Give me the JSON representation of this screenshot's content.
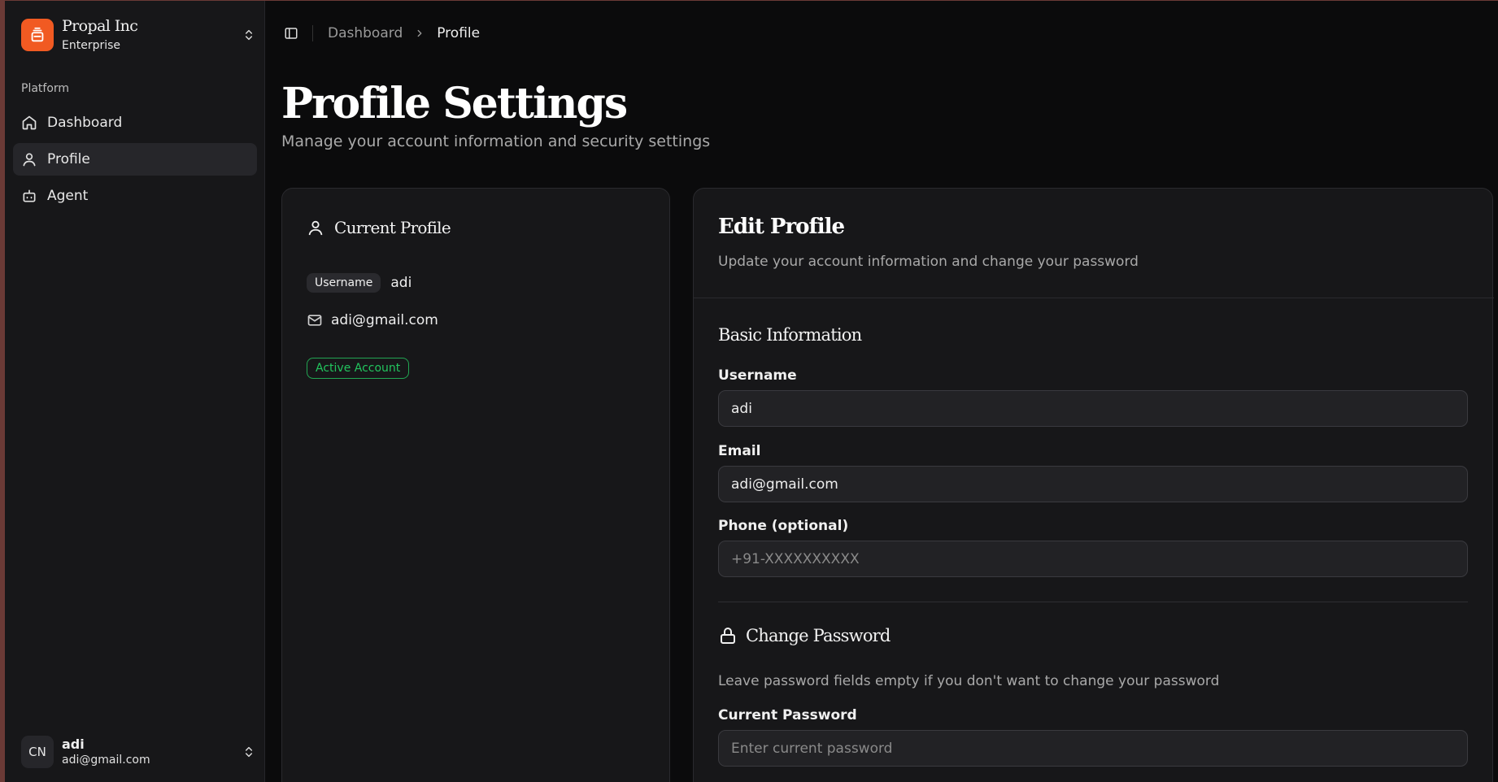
{
  "colors": {
    "accent": "#f15a22",
    "success": "#22c55e",
    "background": "#0b0b0c",
    "panel": "#171719"
  },
  "sidebar": {
    "team": {
      "name": "Propal Inc",
      "plan": "Enterprise",
      "logo_icon": "layers-icon"
    },
    "section_label": "Platform",
    "items": [
      {
        "label": "Dashboard",
        "icon": "home-icon",
        "active": false
      },
      {
        "label": "Profile",
        "icon": "user-icon",
        "active": true
      },
      {
        "label": "Agent",
        "icon": "bot-icon",
        "active": false
      }
    ],
    "user": {
      "avatar_initials": "CN",
      "name": "adi",
      "email": "adi@gmail.com"
    }
  },
  "header": {
    "breadcrumb": [
      "Dashboard",
      "Profile"
    ]
  },
  "page": {
    "title": "Profile Settings",
    "subtitle": "Manage your account information and security settings"
  },
  "current_profile": {
    "title": "Current Profile",
    "username_label": "Username",
    "username": "adi",
    "email": "adi@gmail.com",
    "status": "Active Account"
  },
  "edit_profile": {
    "title": "Edit Profile",
    "subtitle": "Update your account information and change your password",
    "basic_title": "Basic Information",
    "username_label": "Username",
    "username_value": "adi",
    "email_label": "Email",
    "email_value": "adi@gmail.com",
    "phone_label": "Phone (optional)",
    "phone_placeholder": "+91-XXXXXXXXXX",
    "password_title": "Change Password",
    "password_hint": "Leave password fields empty if you don't want to change your password",
    "current_password_label": "Current Password",
    "current_password_placeholder": "Enter current password"
  }
}
